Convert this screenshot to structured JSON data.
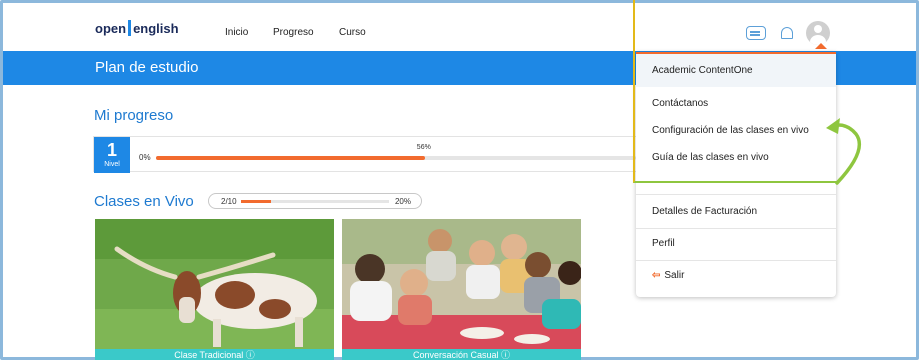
{
  "nav": {
    "logo_open": "open",
    "logo_english": "english",
    "links": [
      "Inicio",
      "Progreso",
      "Curso"
    ],
    "icons": [
      "chat-icon",
      "bell-icon",
      "avatar"
    ]
  },
  "study_plan": {
    "title": "Plan de estudio"
  },
  "progress": {
    "title": "Mi progreso",
    "level_number": "1",
    "level_label": "Nivel",
    "start_pct": "0%",
    "current_pct": "56%",
    "value": 56
  },
  "live_classes": {
    "title": "Clases en Vivo",
    "ratio": "2/10",
    "pct": "20%",
    "value": 20,
    "cards": [
      {
        "caption": "Clase Tradicional"
      },
      {
        "caption": "Conversación Casual"
      }
    ]
  },
  "dropdown": {
    "header": "Academic ContentOne",
    "items": [
      "Contáctanos",
      "Configuración de las clases en vivo",
      "Guía de las clases en vivo",
      "Detalles de Facturación",
      "Perfil",
      "Salir"
    ]
  },
  "colors": {
    "brand_blue": "#1e88e5",
    "accent_orange": "#f26b2e",
    "caption_teal": "#3ac9c9",
    "annotation_green": "#8ec63f",
    "annotation_yellow": "#e3b919"
  }
}
